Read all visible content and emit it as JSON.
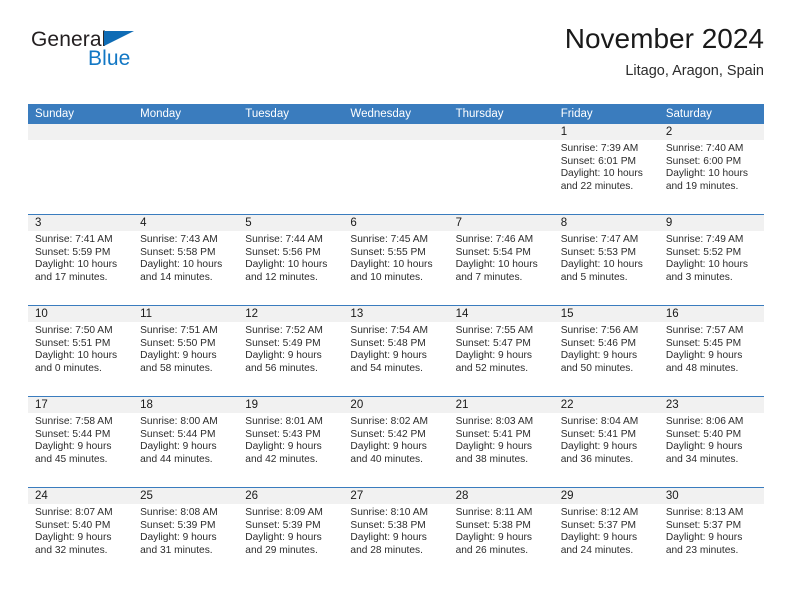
{
  "brand": {
    "name_top": "General",
    "name_bottom": "Blue"
  },
  "header": {
    "title": "November 2024",
    "subtitle": "Litago, Aragon, Spain"
  },
  "colors": {
    "header_blue": "#3a7cbe",
    "brand_blue": "#1277c4",
    "daynum_band": "#f1f1f1"
  },
  "weekdays": [
    "Sunday",
    "Monday",
    "Tuesday",
    "Wednesday",
    "Thursday",
    "Friday",
    "Saturday"
  ],
  "labels": {
    "sunrise_prefix": "Sunrise:",
    "sunset_prefix": "Sunset:",
    "daylight_prefix": "Daylight:"
  },
  "weeks": [
    [
      {
        "day": "",
        "empty": true
      },
      {
        "day": "",
        "empty": true
      },
      {
        "day": "",
        "empty": true
      },
      {
        "day": "",
        "empty": true
      },
      {
        "day": "",
        "empty": true
      },
      {
        "day": "1",
        "sunrise": "Sunrise: 7:39 AM",
        "sunset": "Sunset: 6:01 PM",
        "daylight": "Daylight: 10 hours and 22 minutes."
      },
      {
        "day": "2",
        "sunrise": "Sunrise: 7:40 AM",
        "sunset": "Sunset: 6:00 PM",
        "daylight": "Daylight: 10 hours and 19 minutes."
      }
    ],
    [
      {
        "day": "3",
        "sunrise": "Sunrise: 7:41 AM",
        "sunset": "Sunset: 5:59 PM",
        "daylight": "Daylight: 10 hours and 17 minutes."
      },
      {
        "day": "4",
        "sunrise": "Sunrise: 7:43 AM",
        "sunset": "Sunset: 5:58 PM",
        "daylight": "Daylight: 10 hours and 14 minutes."
      },
      {
        "day": "5",
        "sunrise": "Sunrise: 7:44 AM",
        "sunset": "Sunset: 5:56 PM",
        "daylight": "Daylight: 10 hours and 12 minutes."
      },
      {
        "day": "6",
        "sunrise": "Sunrise: 7:45 AM",
        "sunset": "Sunset: 5:55 PM",
        "daylight": "Daylight: 10 hours and 10 minutes."
      },
      {
        "day": "7",
        "sunrise": "Sunrise: 7:46 AM",
        "sunset": "Sunset: 5:54 PM",
        "daylight": "Daylight: 10 hours and 7 minutes."
      },
      {
        "day": "8",
        "sunrise": "Sunrise: 7:47 AM",
        "sunset": "Sunset: 5:53 PM",
        "daylight": "Daylight: 10 hours and 5 minutes."
      },
      {
        "day": "9",
        "sunrise": "Sunrise: 7:49 AM",
        "sunset": "Sunset: 5:52 PM",
        "daylight": "Daylight: 10 hours and 3 minutes."
      }
    ],
    [
      {
        "day": "10",
        "sunrise": "Sunrise: 7:50 AM",
        "sunset": "Sunset: 5:51 PM",
        "daylight": "Daylight: 10 hours and 0 minutes."
      },
      {
        "day": "11",
        "sunrise": "Sunrise: 7:51 AM",
        "sunset": "Sunset: 5:50 PM",
        "daylight": "Daylight: 9 hours and 58 minutes."
      },
      {
        "day": "12",
        "sunrise": "Sunrise: 7:52 AM",
        "sunset": "Sunset: 5:49 PM",
        "daylight": "Daylight: 9 hours and 56 minutes."
      },
      {
        "day": "13",
        "sunrise": "Sunrise: 7:54 AM",
        "sunset": "Sunset: 5:48 PM",
        "daylight": "Daylight: 9 hours and 54 minutes."
      },
      {
        "day": "14",
        "sunrise": "Sunrise: 7:55 AM",
        "sunset": "Sunset: 5:47 PM",
        "daylight": "Daylight: 9 hours and 52 minutes."
      },
      {
        "day": "15",
        "sunrise": "Sunrise: 7:56 AM",
        "sunset": "Sunset: 5:46 PM",
        "daylight": "Daylight: 9 hours and 50 minutes."
      },
      {
        "day": "16",
        "sunrise": "Sunrise: 7:57 AM",
        "sunset": "Sunset: 5:45 PM",
        "daylight": "Daylight: 9 hours and 48 minutes."
      }
    ],
    [
      {
        "day": "17",
        "sunrise": "Sunrise: 7:58 AM",
        "sunset": "Sunset: 5:44 PM",
        "daylight": "Daylight: 9 hours and 45 minutes."
      },
      {
        "day": "18",
        "sunrise": "Sunrise: 8:00 AM",
        "sunset": "Sunset: 5:44 PM",
        "daylight": "Daylight: 9 hours and 44 minutes."
      },
      {
        "day": "19",
        "sunrise": "Sunrise: 8:01 AM",
        "sunset": "Sunset: 5:43 PM",
        "daylight": "Daylight: 9 hours and 42 minutes."
      },
      {
        "day": "20",
        "sunrise": "Sunrise: 8:02 AM",
        "sunset": "Sunset: 5:42 PM",
        "daylight": "Daylight: 9 hours and 40 minutes."
      },
      {
        "day": "21",
        "sunrise": "Sunrise: 8:03 AM",
        "sunset": "Sunset: 5:41 PM",
        "daylight": "Daylight: 9 hours and 38 minutes."
      },
      {
        "day": "22",
        "sunrise": "Sunrise: 8:04 AM",
        "sunset": "Sunset: 5:41 PM",
        "daylight": "Daylight: 9 hours and 36 minutes."
      },
      {
        "day": "23",
        "sunrise": "Sunrise: 8:06 AM",
        "sunset": "Sunset: 5:40 PM",
        "daylight": "Daylight: 9 hours and 34 minutes."
      }
    ],
    [
      {
        "day": "24",
        "sunrise": "Sunrise: 8:07 AM",
        "sunset": "Sunset: 5:40 PM",
        "daylight": "Daylight: 9 hours and 32 minutes."
      },
      {
        "day": "25",
        "sunrise": "Sunrise: 8:08 AM",
        "sunset": "Sunset: 5:39 PM",
        "daylight": "Daylight: 9 hours and 31 minutes."
      },
      {
        "day": "26",
        "sunrise": "Sunrise: 8:09 AM",
        "sunset": "Sunset: 5:39 PM",
        "daylight": "Daylight: 9 hours and 29 minutes."
      },
      {
        "day": "27",
        "sunrise": "Sunrise: 8:10 AM",
        "sunset": "Sunset: 5:38 PM",
        "daylight": "Daylight: 9 hours and 28 minutes."
      },
      {
        "day": "28",
        "sunrise": "Sunrise: 8:11 AM",
        "sunset": "Sunset: 5:38 PM",
        "daylight": "Daylight: 9 hours and 26 minutes."
      },
      {
        "day": "29",
        "sunrise": "Sunrise: 8:12 AM",
        "sunset": "Sunset: 5:37 PM",
        "daylight": "Daylight: 9 hours and 24 minutes."
      },
      {
        "day": "30",
        "sunrise": "Sunrise: 8:13 AM",
        "sunset": "Sunset: 5:37 PM",
        "daylight": "Daylight: 9 hours and 23 minutes."
      }
    ]
  ]
}
